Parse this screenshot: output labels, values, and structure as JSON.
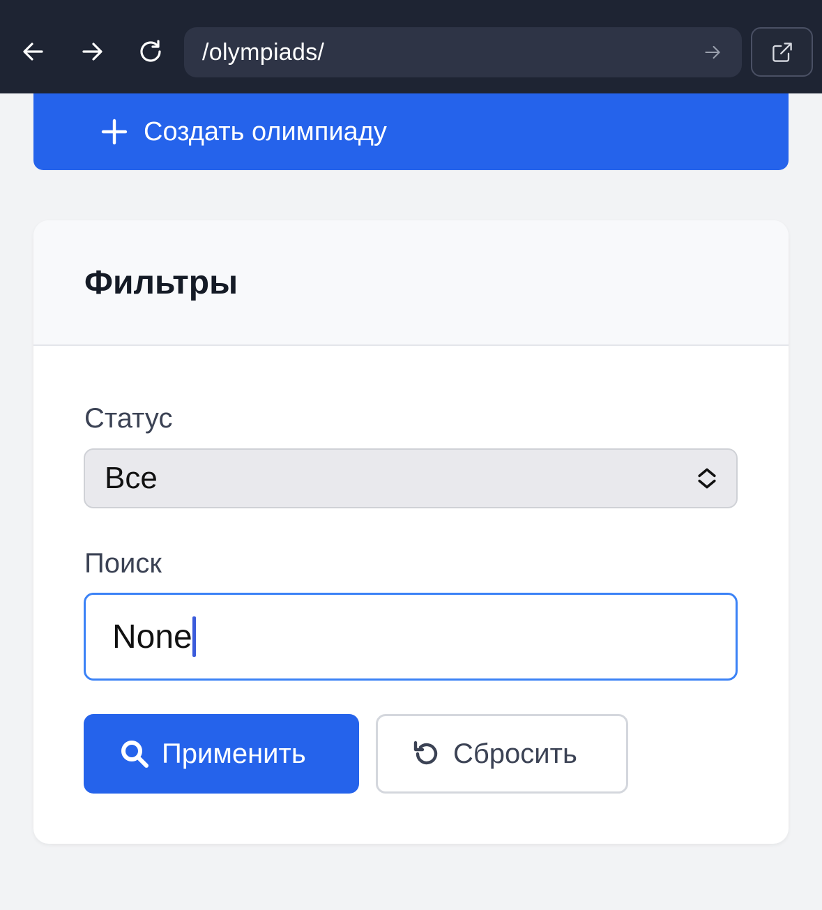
{
  "browser": {
    "url": "/olympiads/",
    "icons": [
      "arrow-left-icon",
      "arrow-right-icon",
      "reload-icon",
      "url-go-arrow-icon",
      "external-link-icon"
    ]
  },
  "actions": {
    "create_label": "Создать олимпиаду",
    "create_icon": "plus-icon"
  },
  "filters": {
    "title": "Фильтры",
    "status_label": "Статус",
    "status_value": "Все",
    "search_label": "Поиск",
    "search_value": "None",
    "apply_label": "Применить",
    "apply_icon": "search-icon",
    "reset_label": "Сбросить",
    "reset_icon": "undo-icon"
  },
  "colors": {
    "topbar": "#1e2433",
    "primary": "#2563eb",
    "focus_border": "#3b82f6",
    "page_bg": "#f2f3f5"
  }
}
